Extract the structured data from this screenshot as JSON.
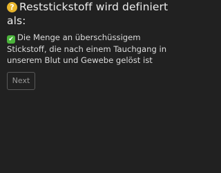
{
  "question": {
    "icon": "question-icon",
    "icon_glyph": "?",
    "icon_color": "#e8b52c",
    "text": "Reststickstoff wird definiert als:"
  },
  "answer": {
    "icon": "check-icon",
    "icon_glyph": "✔",
    "icon_color": "#4bb33b",
    "text": "Die Menge an überschüssigem Stickstoff, die nach einem Tauchgang in unserem Blut und Gewebe gelöst ist"
  },
  "controls": {
    "next_label": "Next"
  }
}
